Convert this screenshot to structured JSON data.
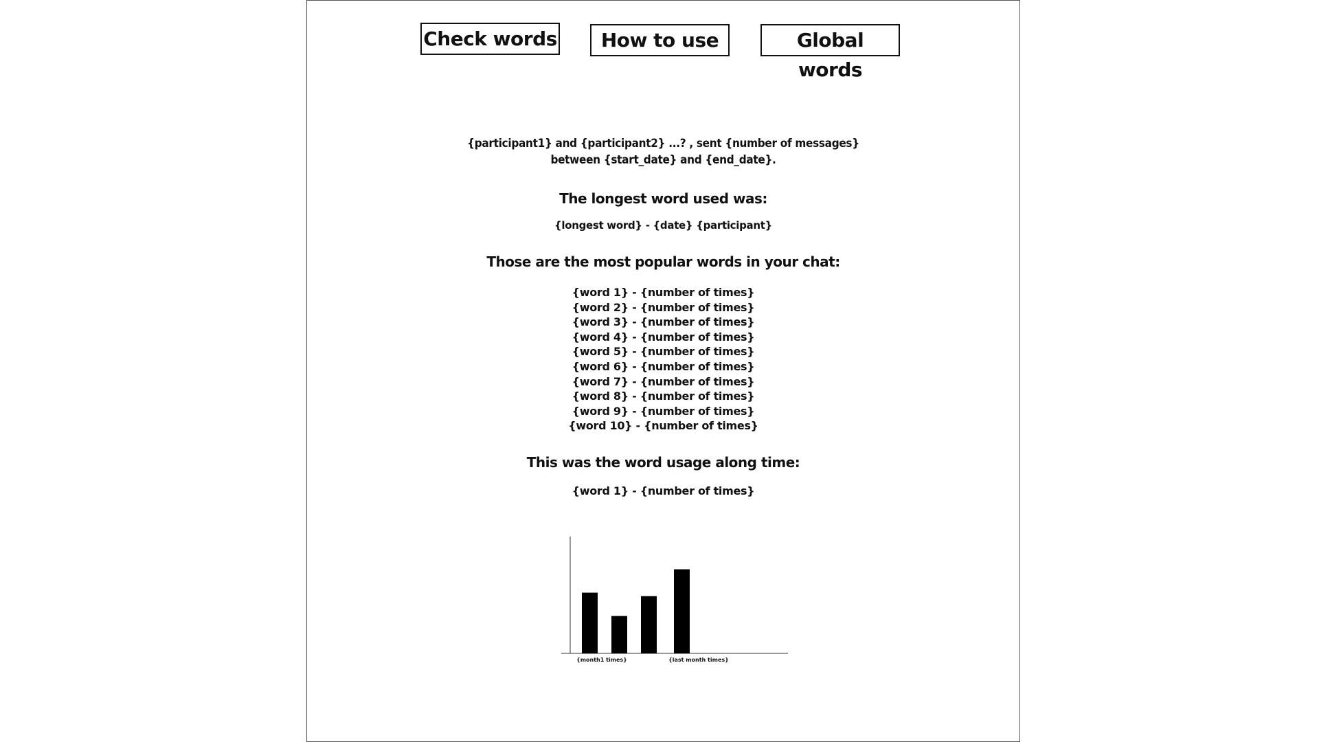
{
  "nav": {
    "check_words": "Check words",
    "how_to_use": "How to use",
    "global_words": "Global words"
  },
  "summary": {
    "line1": "{participant1} and {participant2} ...? , sent {number of messages}",
    "line2": "between {start_date} and {end_date}."
  },
  "longest": {
    "heading": "The longest word used was:",
    "value": "{longest word} - {date} {participant}"
  },
  "popular": {
    "heading": "Those are the most popular words in your chat:",
    "items": [
      "{word 1} - {number of times}",
      "{word 2} - {number of times}",
      "{word 3} - {number of times}",
      "{word 4} - {number of times}",
      "{word 5} - {number of times}",
      "{word 6} - {number of times}",
      "{word 7} - {number of times}",
      "{word 8} - {number of times}",
      "{word 9} - {number of times}",
      "{word 10} - {number of times}"
    ]
  },
  "usage": {
    "heading": "This was the word usage along time:",
    "selected_word": "{word 1} - {number of times}"
  },
  "chart_data": {
    "type": "bar",
    "categories": [
      "{month1 times}",
      "",
      "",
      "{last month times}"
    ],
    "values": [
      0.52,
      0.32,
      0.49,
      0.72
    ],
    "title": "",
    "xlabel": "",
    "ylabel": "",
    "ylim": [
      0,
      1
    ],
    "grid": false,
    "bar_color": "#000000"
  }
}
